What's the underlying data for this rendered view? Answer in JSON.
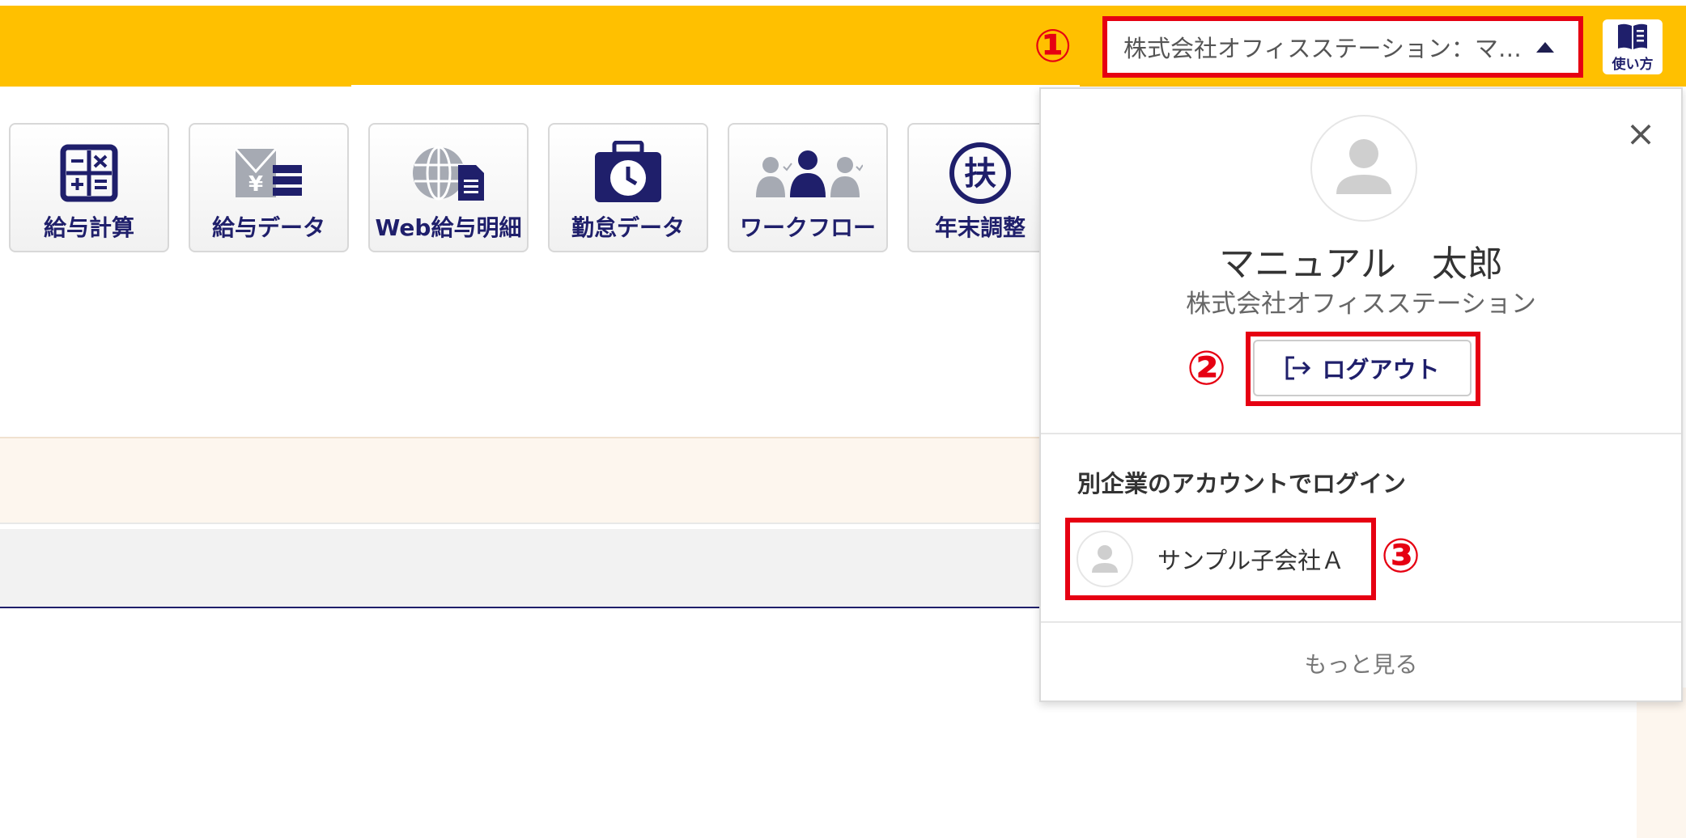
{
  "header": {
    "account_label": "株式会社オフィスステーション：マ…",
    "manual_label": "使い方",
    "marker_1": "①"
  },
  "tiles": [
    {
      "label": "給与計算",
      "icon": "calculator-icon"
    },
    {
      "label": "給与データ",
      "icon": "salary-data-icon"
    },
    {
      "label": "Web給与明細",
      "icon": "web-payslip-icon"
    },
    {
      "label": "勤怠データ",
      "icon": "attendance-clock-icon"
    },
    {
      "label": "ワークフロー",
      "icon": "workflow-people-icon"
    },
    {
      "label": "年末調整",
      "icon": "fu-circle-icon"
    }
  ],
  "panel": {
    "user_name": "マニュアル　太郎",
    "company": "株式会社オフィスステーション",
    "logout_label": "ログアウト",
    "marker_2": "②",
    "section_title": "別企業のアカウントでログイン",
    "accounts": [
      {
        "name": "サンプル子会社Ａ"
      }
    ],
    "marker_3": "③",
    "more_label": "もっと見る"
  },
  "colors": {
    "header_bg": "#ffc000",
    "accent_navy": "#1f1f6b",
    "highlight_red": "#e60012"
  }
}
